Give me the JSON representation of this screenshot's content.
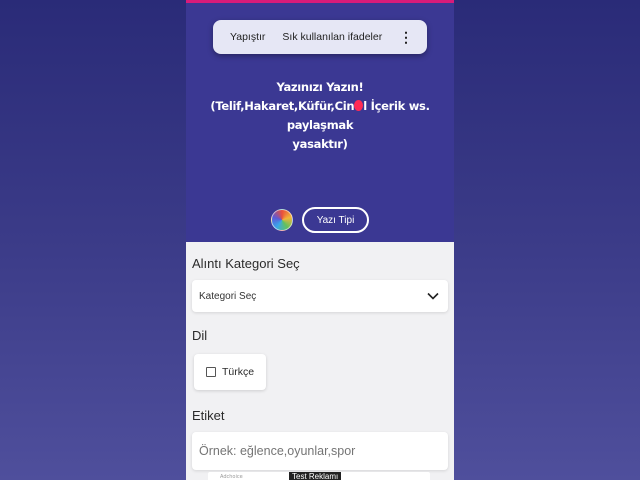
{
  "context_menu": {
    "paste": "Yapıştır",
    "frequent_phrases": "Sık kullanılan ifadeler",
    "more_icon": "more-vertical-icon"
  },
  "editor": {
    "line1": "Yazınızı Yazın!",
    "line2_before": "(Telif,Hakaret,Küfür,Cin",
    "line2_after": "l İçerik ws. paylaşmak",
    "line3": "yasaktır)",
    "cursor_color": "#ff2a55"
  },
  "font_button": {
    "label": "Yazı Tipi"
  },
  "form": {
    "category_label": "Alıntı Kategori Seç",
    "category_value": "Kategori Seç",
    "language_label": "Dil",
    "language_option": "Türkçe",
    "language_checked": false,
    "tag_label": "Etiket",
    "tag_placeholder": "Örnek: eğlence,oyunlar,spor",
    "tag_value": ""
  },
  "ad": {
    "label": "Test Reklamı",
    "small_text": "Adchoice"
  },
  "colors": {
    "editor_bg": "#3b3893",
    "top_accent": "#d81b7a",
    "form_bg": "#f1f1f3"
  }
}
